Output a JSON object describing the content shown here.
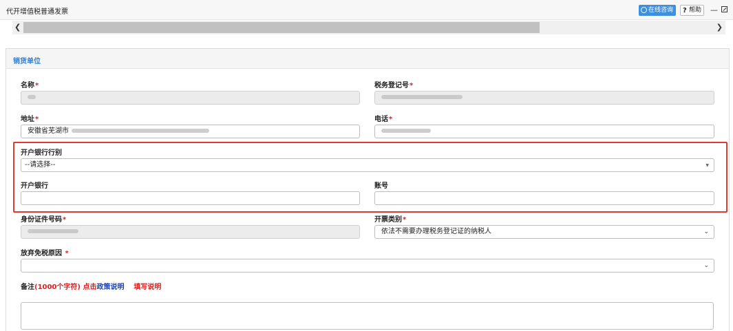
{
  "window": {
    "title": "代开增值税普通发票",
    "consult_label": "在线咨询",
    "help_label": "帮助",
    "minimize_glyph": "—"
  },
  "section": {
    "title": "销货单位"
  },
  "form": {
    "name": {
      "label": "名称",
      "required_mark": "*"
    },
    "tax_id": {
      "label": "税务登记号",
      "required_mark": "*"
    },
    "address": {
      "label": "地址",
      "required_mark": "*",
      "value_visible": "安徽省芜湖市"
    },
    "phone": {
      "label": "电话",
      "required_mark": "*"
    },
    "bank_type": {
      "label": "开户银行行别",
      "value": "--请选择--"
    },
    "bank": {
      "label": "开户银行",
      "value": ""
    },
    "account": {
      "label": "账号",
      "value": ""
    },
    "id_number": {
      "label": "身份证件号码",
      "required_mark": "*"
    },
    "invoice_type": {
      "label": "开票类别",
      "required_mark": "*",
      "value": "依法不需要办理税务登记证的纳税人"
    },
    "exempt_reason": {
      "label": "放弃免税原因",
      "required_mark": "*",
      "value": ""
    },
    "remarks": {
      "label_prefix": "备注",
      "limit": "(1000个字符)",
      "click": "点击",
      "policy_link": "政策说明",
      "fill_link": "填写说明"
    }
  },
  "colors": {
    "accent": "#2e7fd0",
    "highlight_border": "#e03a2f",
    "required": "#e02020",
    "link_blue": "#1a3fb8"
  }
}
